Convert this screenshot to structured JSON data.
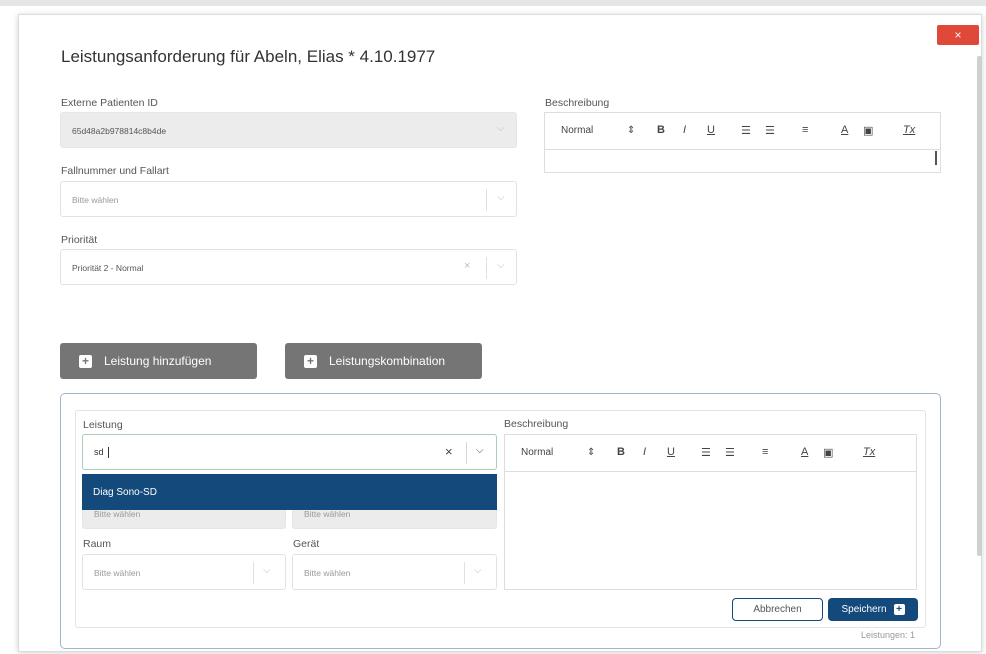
{
  "dialog": {
    "title": "Leistungsanforderung für Abeln, Elias * 4.10.1977",
    "close_label": "×"
  },
  "form": {
    "external_id": {
      "label": "Externe Patienten ID",
      "value": "65d48a2b978814c8b4de"
    },
    "case": {
      "label": "Fallnummer und Fallart",
      "placeholder": "Bitte wählen"
    },
    "priority": {
      "label": "Priorität",
      "value": "Priorität 2 - Normal"
    },
    "description": {
      "label": "Beschreibung"
    }
  },
  "editor_toolbar": {
    "format": "Normal",
    "bold": "B",
    "italic": "I",
    "underline": "U",
    "align": "≡",
    "color": "A",
    "clear": "Tx"
  },
  "actions": {
    "add_service": "Leistung hinzufügen",
    "service_combo": "Leistungskombination"
  },
  "service": {
    "label": "Leistung",
    "input_value": "sd",
    "dropdown_option": "Diag Sono-SD",
    "hidden_field_1_placeholder": "Bitte wählen",
    "hidden_field_2_placeholder": "Bitte wählen",
    "room_label": "Raum",
    "room_placeholder": "Bitte wählen",
    "device_label": "Gerät",
    "device_placeholder": "Bitte wählen",
    "description_label": "Beschreibung",
    "cancel": "Abbrechen",
    "save": "Speichern",
    "count": "Leistungen: 1"
  }
}
